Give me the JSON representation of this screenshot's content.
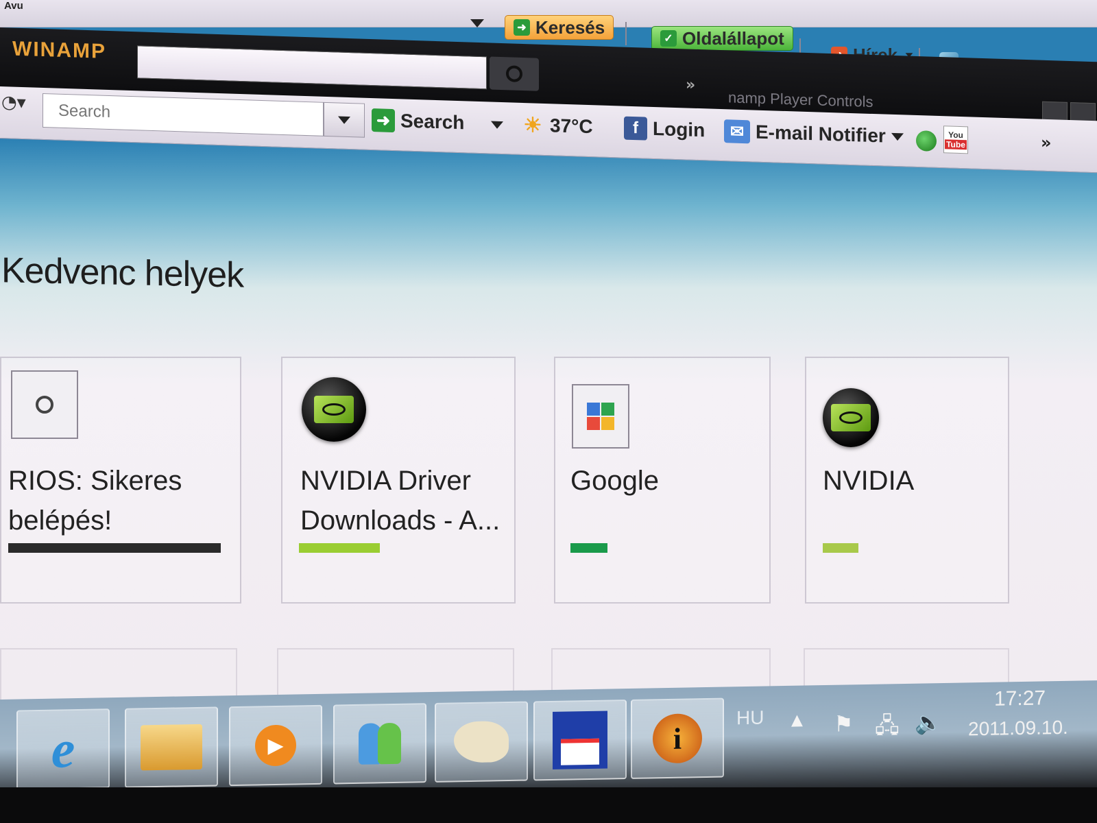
{
  "toolbar_top": {
    "brand_fragment": "Avu",
    "search_button": "Keresés",
    "status_button": "Oldalállapot",
    "news_button": "Hírek"
  },
  "winamp": {
    "logo": "WINAMP",
    "more": "»",
    "player_controls": "namp Player Controls"
  },
  "toolbar_search": {
    "search_placeholder": "Search",
    "search_button": "Search",
    "weather": "37°C",
    "login": "Login",
    "email_notifier": "E-mail Notifier",
    "youtube_top": "You",
    "youtube_bottom": "Tube",
    "more": "»"
  },
  "page": {
    "title": "Kedvenc helyek"
  },
  "favorites": [
    {
      "label": "RIOS: Sikeres belépés!",
      "bar_color": "#2a2a2a",
      "icon": "page-icon"
    },
    {
      "label": "NVIDIA Driver Downloads - A...",
      "bar_color": "#9acd32",
      "icon": "nvidia-icon"
    },
    {
      "label": "Google",
      "bar_color": "#1a9a4a",
      "icon": "google-icon"
    },
    {
      "label": "NVIDIA",
      "bar_color": "#a8c94a",
      "icon": "nvidia-icon"
    }
  ],
  "taskbar": {
    "pinned": [
      "internet-explorer-icon",
      "folder-icon",
      "media-player-icon",
      "messenger-icon",
      "paint-icon",
      "floppy-save-icon",
      "info-icon"
    ],
    "language": "HU",
    "time": "17:27",
    "date": "2011.09.10."
  },
  "colors": {
    "header_blue": "#2a7fb3",
    "winamp_bar": "#111113",
    "taskbar": "#a2b7c8"
  }
}
